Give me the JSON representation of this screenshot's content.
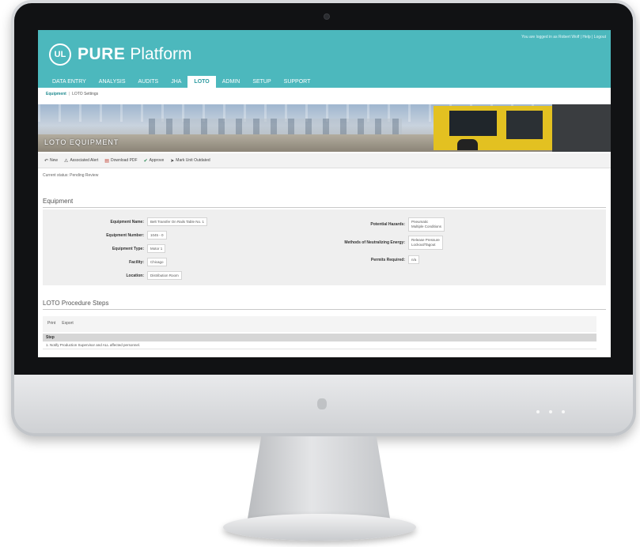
{
  "app": {
    "logo_badge": "UL",
    "logo_pure": "PURE",
    "logo_platform": "Platform",
    "user_links": "You are logged in as Robert Wolf | Help | Logout"
  },
  "nav": {
    "tabs": [
      {
        "label": "DATA ENTRY"
      },
      {
        "label": "ANALYSIS"
      },
      {
        "label": "AUDITS"
      },
      {
        "label": "JHA"
      },
      {
        "label": "LOTO",
        "active": true
      },
      {
        "label": "ADMIN"
      },
      {
        "label": "SETUP"
      },
      {
        "label": "SUPPORT"
      }
    ]
  },
  "breadcrumb": {
    "first": "Equipment",
    "second": "LOTO Settings"
  },
  "banner": {
    "title": "LOTO EQUIPMENT"
  },
  "toolbar": {
    "items": [
      {
        "label": "New",
        "icon": "back-arrow-icon"
      },
      {
        "label": "Associated Alert",
        "icon": "alert-icon"
      },
      {
        "label": "Download PDF",
        "icon": "pdf-icon"
      },
      {
        "label": "Approve",
        "icon": "check-icon"
      },
      {
        "label": "Mark Unit Outdated",
        "icon": "mark-icon"
      }
    ]
  },
  "status": "Current status: Pending Review",
  "equipment": {
    "section_title": "Equipment",
    "left_fields": [
      {
        "label": "Equipment Name:",
        "value": "Belt Transfer On Rails Table No. 1"
      },
      {
        "label": "Equipment Number:",
        "value": "1045 - 0"
      },
      {
        "label": "Equipment Type:",
        "value": "Motor 1"
      },
      {
        "label": "Facility:",
        "value": "Chicago"
      },
      {
        "label": "Location:",
        "value": "Distribution Room"
      }
    ],
    "right_fields": [
      {
        "label": "Potential Hazards:",
        "value": "Pneumatic\nMultiple Conditions"
      },
      {
        "label": "Methods of Neutralizing Energy:",
        "value": "Release Pressure\nLockout/Tagout"
      },
      {
        "label": "Permits Required:",
        "value": "n/a"
      }
    ]
  },
  "procedure": {
    "section_title": "LOTO Procedure Steps",
    "tools": [
      {
        "label": "Print"
      },
      {
        "label": "Export"
      }
    ],
    "column_header": "Step",
    "rows": [
      "1. Notify Production Supervisor and ALL affected personnel."
    ]
  },
  "colors": {
    "brand_teal": "#4cb8bd",
    "active_tab_text": "#2b9aa0",
    "forklift_yellow": "#e3c121"
  }
}
